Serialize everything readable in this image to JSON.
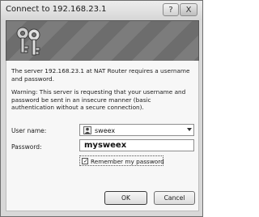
{
  "window": {
    "title": "Connect to 192.168.23.1",
    "help_button": "?",
    "close_button": "X"
  },
  "message": {
    "line1": "The server 192.168.23.1 at NAT Router requires a username and password.",
    "warning": "Warning: This server is requesting that your username and password be sent in an insecure manner (basic authentication without a secure connection)."
  },
  "form": {
    "username_label": "User name:",
    "username_value": "sweex",
    "password_label": "Password:",
    "password_value": "mysweex",
    "remember_label": "Remember my password",
    "remember_checked": true
  },
  "buttons": {
    "ok": "OK",
    "cancel": "Cancel"
  },
  "icons": {
    "banner": "keys-icon",
    "user": "user-icon",
    "dropdown": "chevron-down-icon",
    "check": "check-icon"
  }
}
